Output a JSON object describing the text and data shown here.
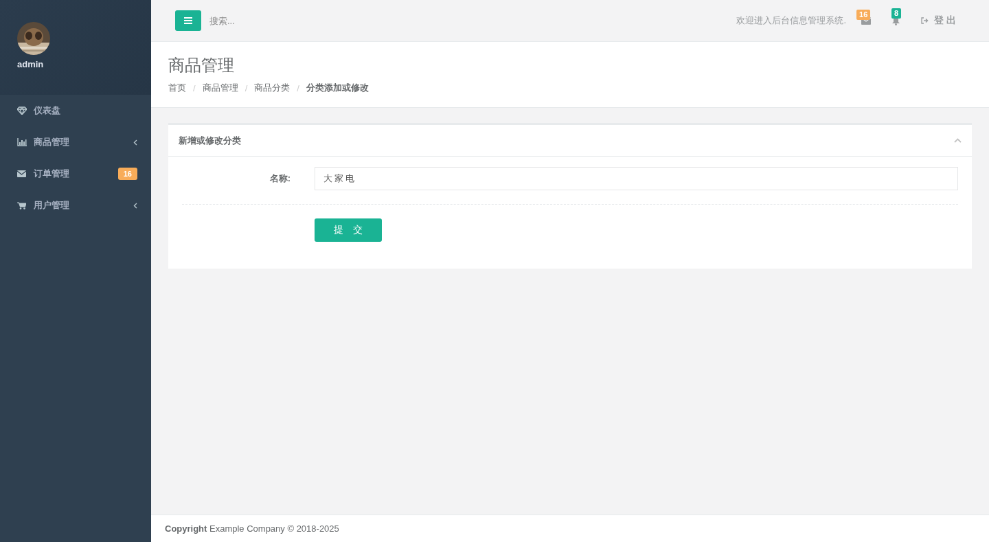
{
  "sidebar": {
    "user": {
      "name": "admin"
    },
    "items": [
      {
        "label": "仪表盘",
        "expandable": false
      },
      {
        "label": "商品管理",
        "expandable": true
      },
      {
        "label": "订单管理",
        "badge": "16",
        "expandable": false
      },
      {
        "label": "用户管理",
        "expandable": true
      }
    ]
  },
  "topbar": {
    "search": {
      "placeholder": "搜索..."
    },
    "welcome": "欢迎进入后台信息管理系统.",
    "mail_badge": "16",
    "bell_badge": "8",
    "logout": "登 出"
  },
  "page_header": {
    "title": "商品管理",
    "breadcrumb": [
      "首页",
      "商品管理",
      "商品分类",
      "分类添加或修改"
    ],
    "separator": "/"
  },
  "panel": {
    "title": "新增或修改分类",
    "collapsed": false,
    "form": {
      "label": "名称:",
      "value": "大家电",
      "submit": "提　交"
    }
  },
  "footer": {
    "copyright_label": "Copyright",
    "copyright_text": " Example Company © 2018-2025"
  }
}
